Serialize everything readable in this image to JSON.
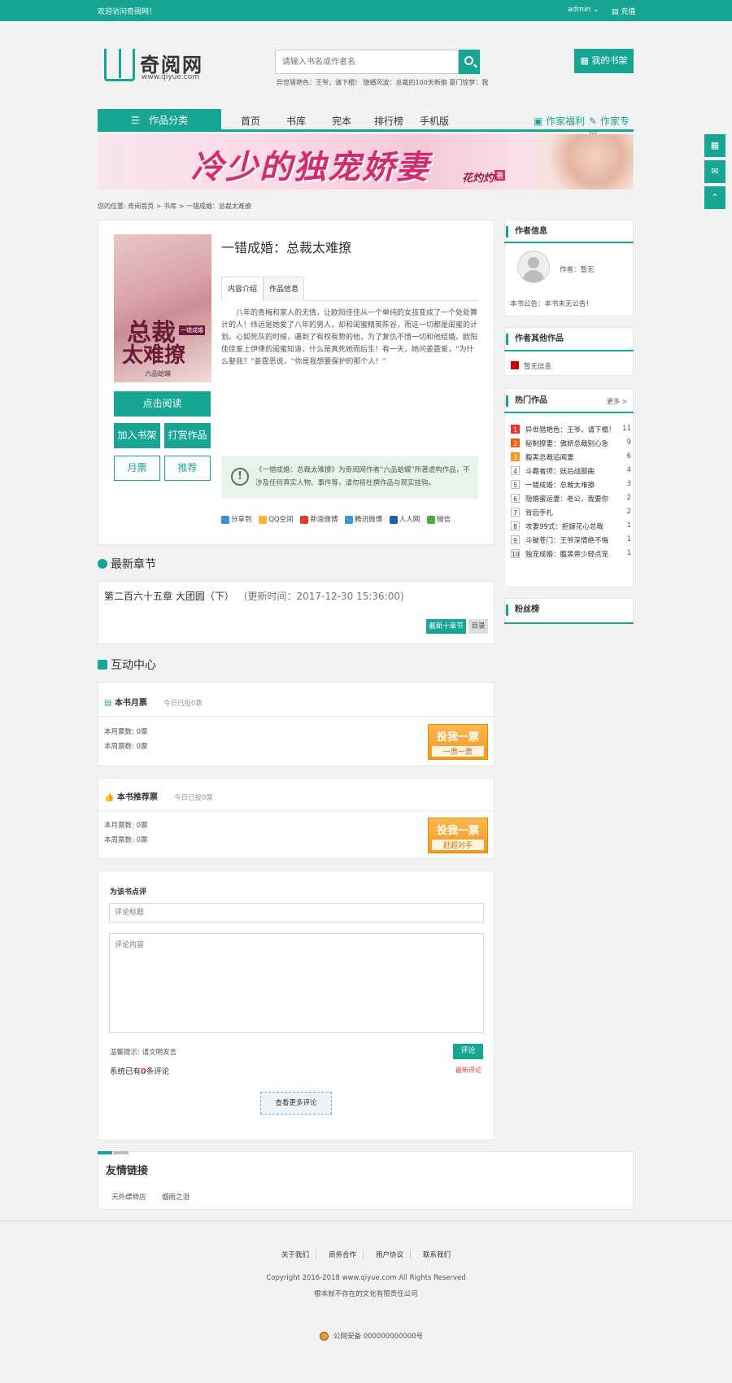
{
  "topbar": {
    "welcome": "欢迎访问奇阅网！",
    "user": "admin",
    "recharge": "充值"
  },
  "header": {
    "logo_text": "奇阅网",
    "logo_url": "www.qiyue.com",
    "search_placeholder": "请输入书名或作者名",
    "hot_search": "异世猎艳色：王爷，请下榻！ 隐婚风波：总裁的100天新娘 豪门惊梦：我",
    "shelf_label": "我的书架"
  },
  "nav": {
    "category": "作品分类",
    "items": [
      "首页",
      "书库",
      "完本",
      "排行榜",
      "手机版"
    ],
    "author_welfare": "作家福利",
    "author_zone": "作家专区"
  },
  "banner": {
    "title": "冷少的独宠娇妻",
    "author": "花灼灼",
    "author_tag": "著"
  },
  "breadcrumb": "您的位置: 奇阅首页 > 书库 > 一错成婚：总裁太难撩",
  "book": {
    "cover_text_1": "总裁",
    "cover_text_2": "太难撩",
    "cover_tag": "一错成婚",
    "cover_pen": "六品蛤蟆",
    "title": "一错成婚：总裁太难撩",
    "tabs": [
      "内容介绍",
      "作品信息"
    ],
    "intro": "八年的青梅和家人的无情，让欧阳佳佳从一个单纯的女孩变成了一个处处算计的人！纬远是她爱了八年的男人，却和闺蜜精英陈谷，而这一切都是闺蜜的计划。心如死灰的时候，遇到了有权有势的他，为了复仇不惜一切和他结婚。欧阳佳佳爱上伊律的闺蜜知道，什么是真死她而后生！有一天，她问姜霆爱，“为什么娶我？”姜霆恶说，“你是我想要保护的那个人！”",
    "read_button": "点击阅读",
    "add_shelf": "加入书架",
    "reward": "打赏作品",
    "monthly": "月票",
    "recommend": "推荐",
    "notice": "《一错成婚：总裁太难撩》为奇阅网作者“六品蛤蟆”所著虚构作品，不涉及任何真实人物、事件等，请勿将杜撰作品与现实挂钩。",
    "share": [
      "分享到",
      "QQ空间",
      "新浪微博",
      "腾讯微博",
      "人人网",
      "微信"
    ]
  },
  "latest": {
    "section_title": "最新章节",
    "chapter": "第二百六十五章 大团圆（下）",
    "update_time": "(更新时间：2017-12-30 15:36:00)",
    "btn_latest": "最新十章节",
    "btn_toc": "目录"
  },
  "interact": {
    "section_title": "互动中心",
    "monthly": {
      "title": "本书月票",
      "today": "今日已投0票",
      "month_line": "本月票数: 0票",
      "week_line": "本周票数: 0票",
      "btn_l1": "投我一票",
      "btn_l2": "一票一票"
    },
    "recommend": {
      "title": "本书推荐票",
      "today": "今日已投0票",
      "month_line": "本月票数: 0票",
      "week_line": "本周票数: 0票",
      "btn_l1": "投我一票",
      "btn_l2": "赶超对手"
    }
  },
  "comment": {
    "label": "为该书点评",
    "title_placeholder": "评论标题",
    "content_placeholder": "评论内容",
    "tip": "温馨提示: 请文明发言",
    "submit": "评论",
    "total_prefix": "系统已有",
    "total_count": "0",
    "total_suffix": "条评论",
    "latest": "最新评论",
    "more": "查看更多评论"
  },
  "friends": {
    "title": "友情链接",
    "links": [
      "天外缥缈店",
      "烟雨之泪"
    ]
  },
  "sidebar": {
    "author_info_title": "作者信息",
    "author_label": "作者：",
    "author_name": "暂无",
    "author_notice": "本书公告：本书未无公告！",
    "other_works_title": "作者其他作品",
    "other_works_item": "暂无信息",
    "hot_title": "热门作品",
    "hot_more": "更多 >",
    "hot_list": [
      {
        "rank": "1",
        "name": "异世猎艳色：王爷，请下榻！",
        "count": "11"
      },
      {
        "rank": "2",
        "name": "秘制撩妻：傲娇总裁别心急",
        "count": "9"
      },
      {
        "rank": "3",
        "name": "腹黑总裁追闻妻",
        "count": "6"
      },
      {
        "rank": "4",
        "name": "斗霸者师：妖后战部曲",
        "count": "4"
      },
      {
        "rank": "5",
        "name": "一错成婚：总裁太难撩",
        "count": "3"
      },
      {
        "rank": "6",
        "name": "隐婚蜜运妻：老公，我要你",
        "count": "2"
      },
      {
        "rank": "7",
        "name": "背后手札",
        "count": "2"
      },
      {
        "rank": "8",
        "name": "攻妻99式：拒嫁花心总裁",
        "count": "1"
      },
      {
        "rank": "9",
        "name": "斗破苍门：王爷深情绝不悔",
        "count": "1"
      },
      {
        "rank": "10",
        "name": "独宠成婚：腹黑帝少轻点宠",
        "count": "1"
      }
    ],
    "fans_title": "粉丝榜"
  },
  "footer": {
    "links": [
      "关于我们",
      "商务合作",
      "用户协议",
      "联系我们"
    ],
    "copyright": "Copyright 2016-2018 www.qiyue.com All Rights Reserved",
    "company": "根本就不存在的文化有限责任公司",
    "police": "公网安备 000000000000号"
  }
}
